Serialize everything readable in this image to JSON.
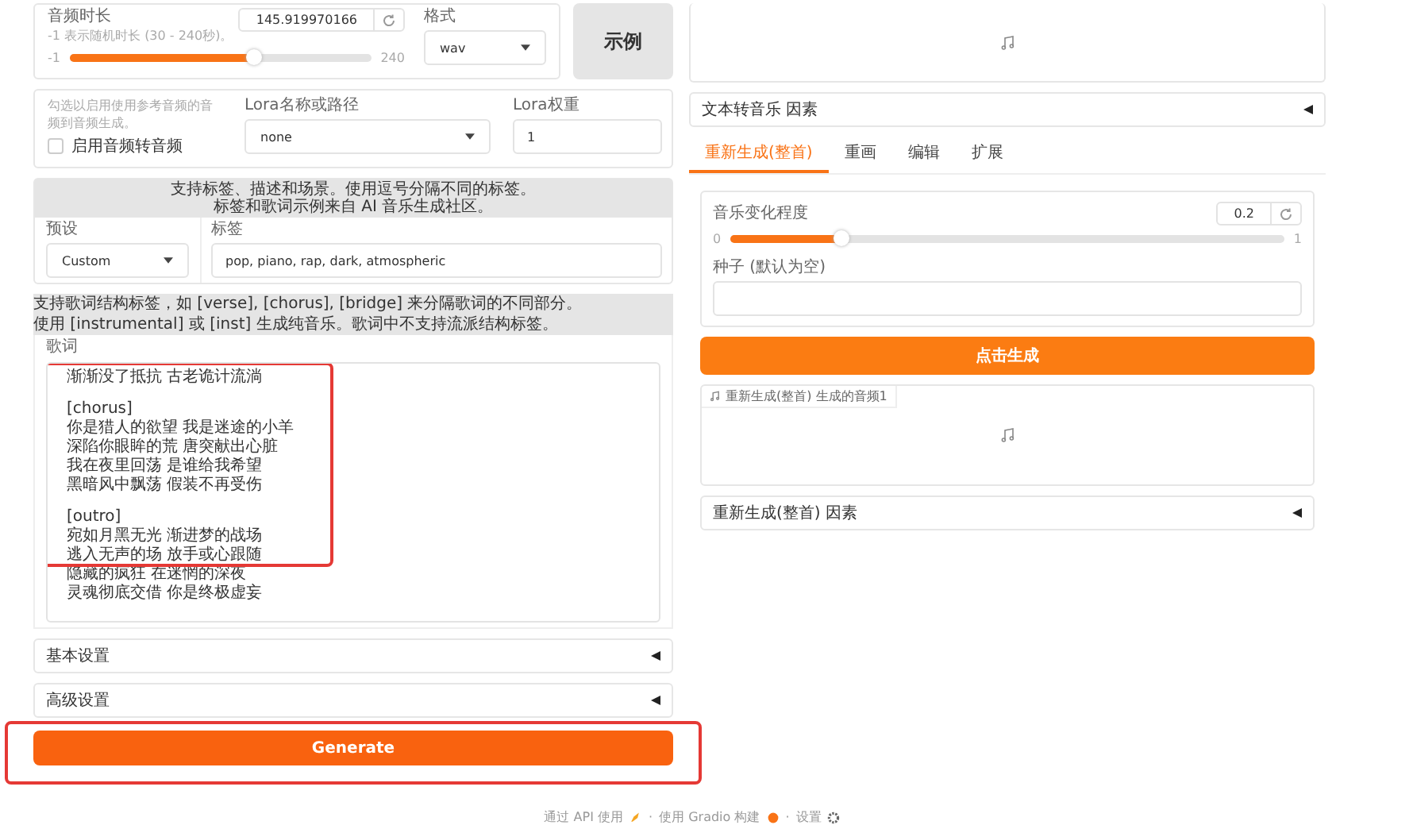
{
  "left": {
    "duration": {
      "label": "音频时长",
      "hint": "-1 表示随机时长 (30 - 240秒)。",
      "value": "145.919970166",
      "min": "-1",
      "max": "240",
      "level": 0.61
    },
    "format": {
      "label": "格式",
      "value": "wav"
    },
    "example_button": "示例",
    "audio2audio": {
      "hint": "勾选以启用使用参考音频的音频到音频生成。",
      "checkbox": {
        "label": "启用音频转音频",
        "checked": false
      }
    },
    "lora_name": {
      "label": "Lora名称或路径",
      "value": "none"
    },
    "lora_weight": {
      "label": "Lora权重",
      "value": "1"
    },
    "tags_info": [
      "支持标签、描述和场景。使用逗号分隔不同的标签。",
      "标签和歌词示例来自 AI 音乐生成社区。"
    ],
    "preset": {
      "label": "预设",
      "value": "Custom"
    },
    "tags": {
      "label": "标签",
      "value": "pop, piano, rap, dark, atmospheric"
    },
    "lyrics_info": [
      "支持歌词结构标签，如 [verse], [chorus], [bridge] 来分隔歌词的不同部分。",
      "使用 [instrumental] 或 [inst] 生成纯音乐。歌词中不支持流派结构标签。"
    ],
    "lyrics": {
      "label": "歌词",
      "stanzas": [
        [
          "渐渐没了抵抗 古老诡计流淌"
        ],
        [
          "[chorus]",
          "你是猎人的欲望 我是迷途的小羊",
          "深陷你眼眸的荒 唐突献出心脏",
          "我在夜里回荡 是谁给我希望",
          "黑暗风中飘荡 假装不再受伤"
        ],
        [
          "[outro]",
          "宛如月黑无光 渐进梦的战场",
          "逃入无声的场 放手或心跟随",
          "隐藏的疯狂 在迷惘的深夜",
          "灵魂彻底交借 你是终极虚妄"
        ]
      ]
    },
    "accordions": [
      {
        "label": "基本设置",
        "expanded": false
      },
      {
        "label": "高级设置",
        "expanded": false
      }
    ],
    "generate_button": "Generate"
  },
  "right": {
    "text2music_accordion": {
      "label": "文本转音乐 因素",
      "expanded": false
    },
    "tabs": [
      {
        "label": "重新生成(整首)",
        "selected": true
      },
      {
        "label": "重画",
        "selected": false
      },
      {
        "label": "编辑",
        "selected": false
      },
      {
        "label": "扩展",
        "selected": false
      }
    ],
    "variance": {
      "label": "音乐变化程度",
      "value": "0.2",
      "min": "0",
      "max": "1",
      "level": 0.2
    },
    "seed": {
      "label": "种子 (默认为空)"
    },
    "generate_button": "点击生成",
    "audio_output": {
      "label": "重新生成(整首) 生成的音频1"
    },
    "retake_accordion": {
      "label": "重新生成(整首) 因素",
      "expanded": false
    }
  },
  "footer": {
    "api": "通过 API 使用",
    "separator_1": "·",
    "gradio": "使用 Gradio 构建",
    "separator_2": "·",
    "settings": "设置"
  }
}
